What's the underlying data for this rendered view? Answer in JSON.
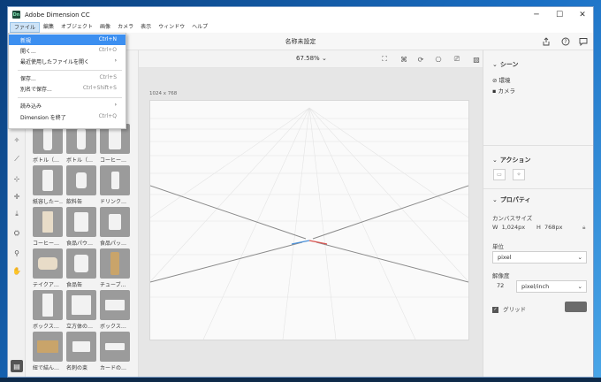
{
  "window": {
    "app_title": "Adobe Dimension CC",
    "app_icon_letters": "Dn",
    "controls": {
      "minimize": "─",
      "maximize": "☐",
      "close": "✕"
    }
  },
  "menu": {
    "items": [
      "ファイル",
      "編集",
      "オブジェクト",
      "画像",
      "カメラ",
      "表示",
      "ウィンドウ",
      "ヘルプ"
    ],
    "active_index": 0
  },
  "header": {
    "doc_title": "名称未設定",
    "share_icon": "share-icon",
    "help_icon": "help-icon",
    "feedback_icon": "feedback-icon"
  },
  "file_menu": {
    "items": [
      {
        "label": "新規",
        "shortcut": "Ctrl+N",
        "highlighted": true
      },
      {
        "label": "開く...",
        "shortcut": "Ctrl+O"
      },
      {
        "label": "最近使用したファイルを開く",
        "shortcut": "›"
      },
      {
        "label": "保存...",
        "shortcut": "Ctrl+S"
      },
      {
        "label": "別名で保存...",
        "shortcut": "Ctrl+Shift+S"
      },
      {
        "label": "読み込み",
        "shortcut": "›"
      },
      {
        "label": "Dimension を終了",
        "shortcut": "Ctrl+Q"
      }
    ]
  },
  "toolbar": {
    "zoom": "67.58%"
  },
  "assets": {
    "items": [
      "ボトル（…",
      "ボトル（…",
      "コーヒー…",
      "紙容したー…",
      "飲料缶",
      "ドリンク…",
      "コーヒー…",
      "食品パウ…",
      "食品パッ…",
      "テイクア…",
      "食品缶",
      "チューブ…",
      "ボックス…",
      "立方体の…",
      "ボックス…",
      "紐で結ん…",
      "名刺の束",
      "カードの…"
    ]
  },
  "canvas": {
    "size_label": "1024 x 768"
  },
  "right_panel": {
    "scene": {
      "title": "シーン",
      "items": [
        {
          "label": "環境",
          "icon": "environment-icon"
        },
        {
          "label": "カメラ",
          "icon": "camera-icon"
        }
      ]
    },
    "actions": {
      "title": "アクション"
    },
    "properties": {
      "title": "プロパティ",
      "canvas_size_label": "カンバスサイズ",
      "width_prefix": "W",
      "width": "1,024px",
      "height_prefix": "H",
      "height": "768px",
      "unit_label": "単位",
      "unit_value": "pixel",
      "resolution_label": "解像度",
      "resolution_value": "72",
      "resolution_unit": "pixel/inch",
      "grid_label": "グリッド",
      "grid_checked": true,
      "grid_color": "#6b6b6b"
    }
  },
  "colors": {
    "accent": "#3c8ff0",
    "axis_x": "#d9534f",
    "axis_z": "#4a90d9"
  }
}
